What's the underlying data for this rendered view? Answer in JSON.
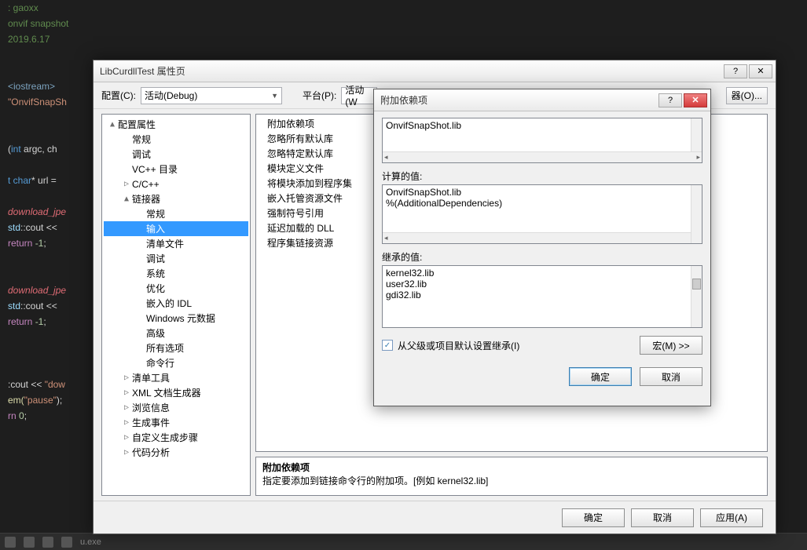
{
  "code": {
    "l0": ": gaoxx",
    "l1": "onvif snapshot",
    "l2": "2019.6.17",
    "l3": "<iostream>",
    "l4": "\"OnvifSnapSh",
    "l5a": "(",
    "l5b": "int",
    "l5c": " argc, ch",
    "l6a": "t ",
    "l6b": "char",
    "l6c": "* url =",
    "l7": "download_jpe",
    "l8a": "std",
    "l8b": "::cout <<",
    "l9a": "return ",
    "l9b": "-1",
    "l9c": ";",
    "l10": "download_jpe",
    "l11a": "std",
    "l11b": "::cout <<",
    "l12a": "return ",
    "l12b": "-1",
    "l12c": ";",
    "l13a": ":cout << ",
    "l13b": "\"dow",
    "l14a": "em(",
    "l14b": "\"pause\"",
    "l14c": ");",
    "l15a": "rn ",
    "l15b": "0",
    "l15c": ";"
  },
  "status": {
    "text": "u.exe"
  },
  "prop": {
    "title": "LibCurdllTest 属性页",
    "cfg_label": "配置(C):",
    "cfg_value": "活动(Debug)",
    "plat_label": "平台(P):",
    "plat_value": "活动(W",
    "mgr": "器(O)...",
    "tree": {
      "root": "配置属性",
      "general": "常规",
      "debug": "调试",
      "vcdir": "VC++ 目录",
      "ccpp": "C/C++",
      "linker": "链接器",
      "l_general": "常规",
      "l_input": "输入",
      "l_manifest": "清单文件",
      "l_debug": "调试",
      "l_system": "系统",
      "l_opt": "优化",
      "l_idl": "嵌入的 IDL",
      "l_winmd": "Windows 元数据",
      "l_adv": "高级",
      "l_all": "所有选项",
      "l_cmd": "命令行",
      "manifest_tool": "清单工具",
      "xml": "XML 文档生成器",
      "browse": "浏览信息",
      "build": "生成事件",
      "custom": "自定义生成步骤",
      "code_analysis": "代码分析"
    },
    "rows": {
      "r0": "附加依赖项",
      "r1": "忽略所有默认库",
      "r2": "忽略特定默认库",
      "r3": "模块定义文件",
      "r4": "将模块添加到程序集",
      "r5": "嵌入托管资源文件",
      "r6": "强制符号引用",
      "r7": "延迟加载的 DLL",
      "r8": "程序集链接资源"
    },
    "desc": {
      "title": "附加依赖项",
      "body": "指定要添加到链接命令行的附加项。[例如 kernel32.lib]"
    },
    "ok": "确定",
    "cancel": "取消",
    "apply": "应用(A)"
  },
  "inner": {
    "title": "附加依赖项",
    "main_value": "OnvifSnapShot.lib",
    "calc_label": "计算的值:",
    "calc_values": [
      "OnvifSnapShot.lib",
      "%(AdditionalDependencies)"
    ],
    "inh_label": "继承的值:",
    "inh_values": [
      "kernel32.lib",
      "user32.lib",
      "gdi32.lib"
    ],
    "inherit_chk": "从父级或项目默认设置继承(I)",
    "macro": "宏(M) >>",
    "ok": "确定",
    "cancel": "取消"
  }
}
